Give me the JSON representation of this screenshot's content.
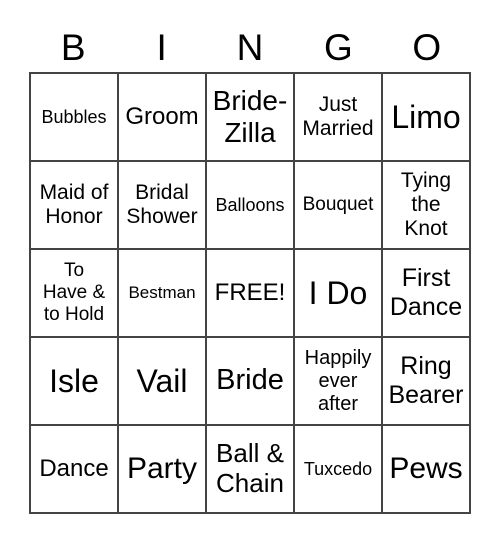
{
  "header": [
    "B",
    "I",
    "N",
    "G",
    "O"
  ],
  "cells": [
    [
      "Bubbles",
      "Groom",
      "Bride-\nZilla",
      "Just\nMarried",
      "Limo"
    ],
    [
      "Maid of\nHonor",
      "Bridal\nShower",
      "Balloons",
      "Bouquet",
      "Tying\nthe\nKnot"
    ],
    [
      "To\nHave &\nto Hold",
      "Bestman",
      "FREE!",
      "I Do",
      "First\nDance"
    ],
    [
      "Isle",
      "Vail",
      "Bride",
      "Happily\never\nafter",
      "Ring\nBearer"
    ],
    [
      "Dance",
      "Party",
      "Ball &\nChain",
      "Tuxcedo",
      "Pews"
    ]
  ]
}
